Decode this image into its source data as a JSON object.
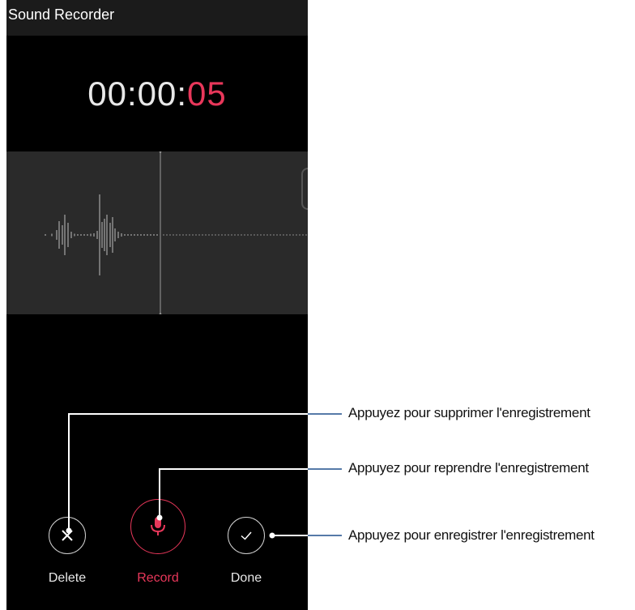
{
  "app": {
    "title": "Sound Recorder"
  },
  "timer": {
    "prefix": "00:00:",
    "seconds": "05"
  },
  "controls": {
    "delete_label": "Delete",
    "record_label": "Record",
    "done_label": "Done"
  },
  "callouts": {
    "delete": "Appuyez pour supprimer l'enregistrement",
    "record": "Appuyez pour reprendre l'enregistrement",
    "done": "Appuyez pour enregistrer l'enregistrement"
  },
  "icons": {
    "delete": "close-icon",
    "record": "microphone-icon",
    "done": "check-icon"
  },
  "colors": {
    "accent": "#e8375a",
    "background": "#000000",
    "waveform_panel": "#2a2a2a",
    "app_bar": "#1b1b1b"
  }
}
